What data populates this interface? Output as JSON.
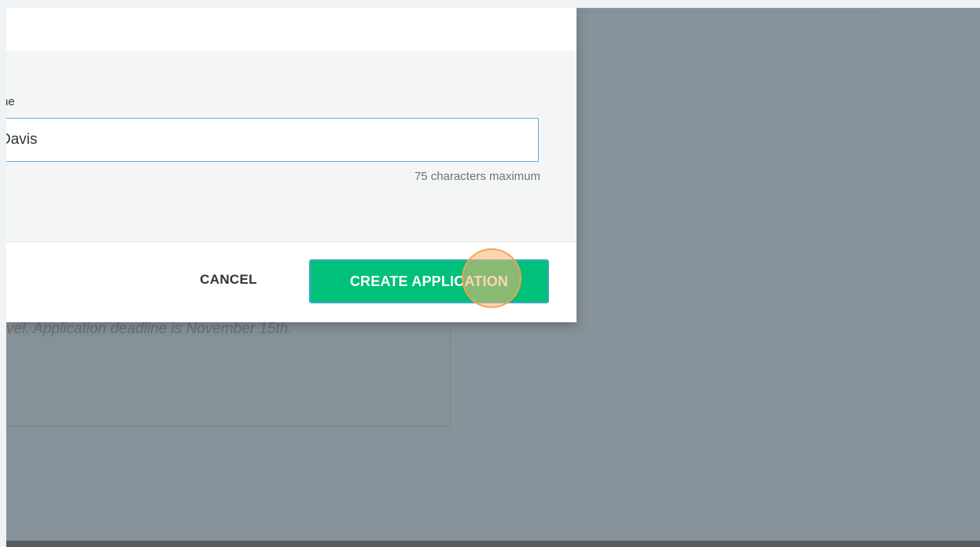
{
  "background": {
    "card_text": "vel. Application deadline is November 15th."
  },
  "dialog": {
    "field_label": "ne",
    "name_value": "Davis",
    "helper_text": "75 characters maximum",
    "cancel_label": "CANCEL",
    "create_label": "CREATE APPLICATION"
  },
  "colors": {
    "primary_button": "#00c07a",
    "input_focus_border": "#63b0dd",
    "overlay": "#87929a"
  }
}
